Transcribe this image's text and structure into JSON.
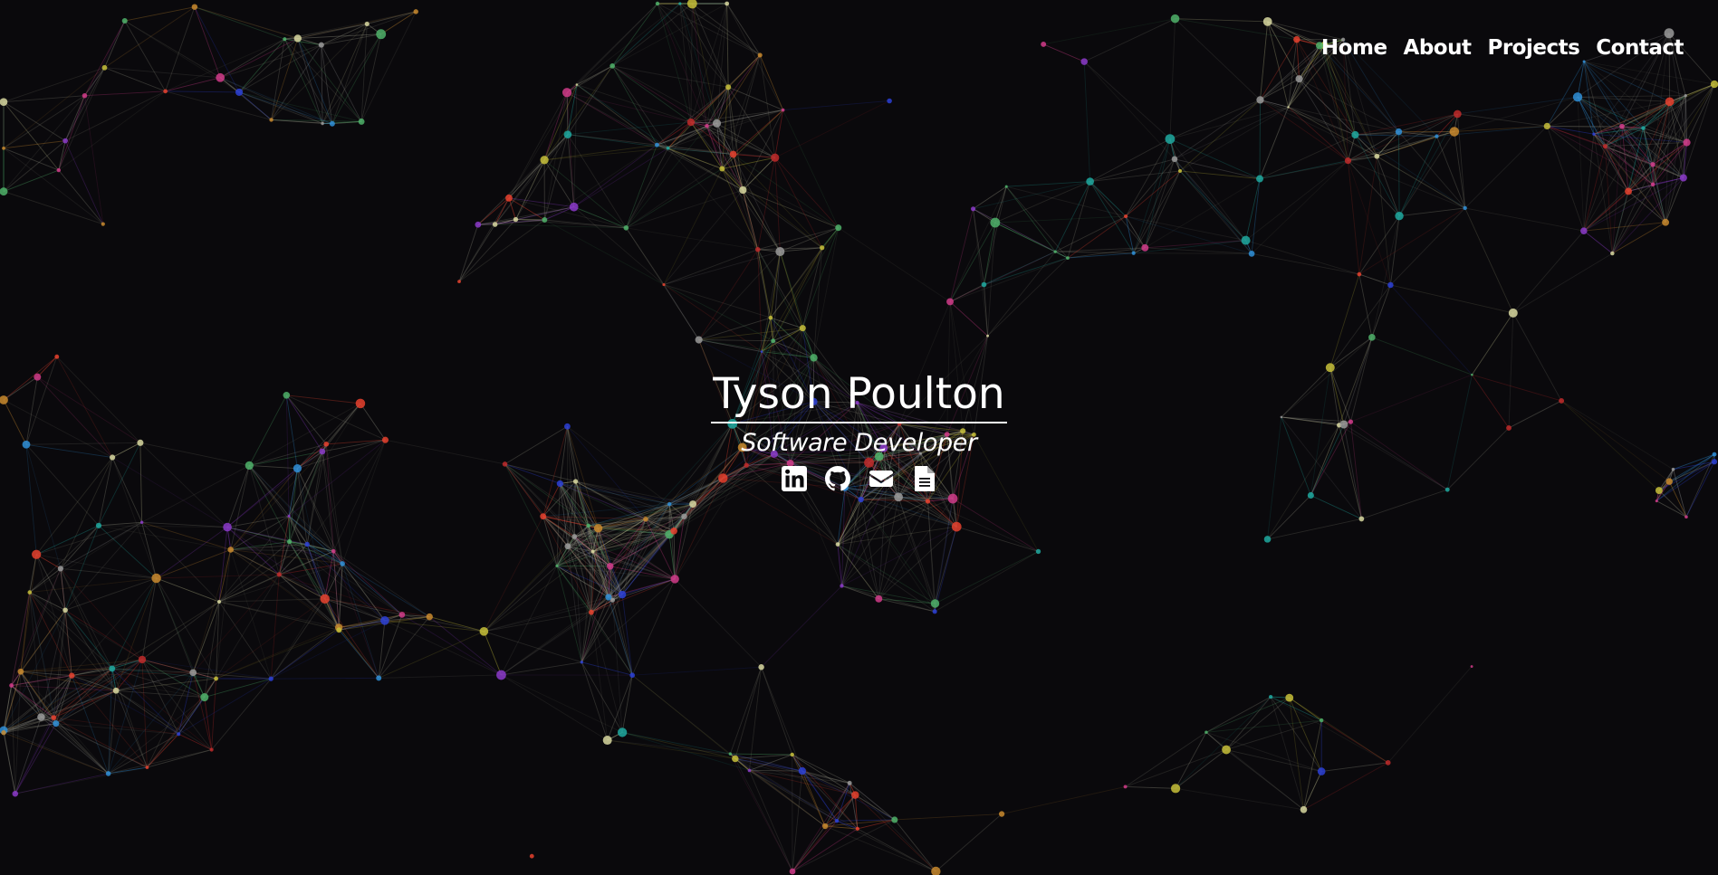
{
  "nav": {
    "items": [
      {
        "label": "Home"
      },
      {
        "label": "About"
      },
      {
        "label": "Projects"
      },
      {
        "label": "Contact"
      }
    ]
  },
  "hero": {
    "name": "Tyson Poulton",
    "title": "Software Developer"
  },
  "socials": [
    {
      "icon": "linkedin-icon"
    },
    {
      "icon": "github-icon"
    },
    {
      "icon": "email-icon"
    },
    {
      "icon": "resume-document-icon"
    }
  ],
  "background": {
    "color": "#0a090c",
    "particle_colors": [
      "#e6412e",
      "#2b3fd6",
      "#c7c03a",
      "#8b39c9",
      "#1fa9a0",
      "#d13b8a",
      "#4fb26a",
      "#c98a2e",
      "#9a9a9a",
      "#d8d8a0",
      "#2f8fd8",
      "#c02a2a"
    ]
  }
}
